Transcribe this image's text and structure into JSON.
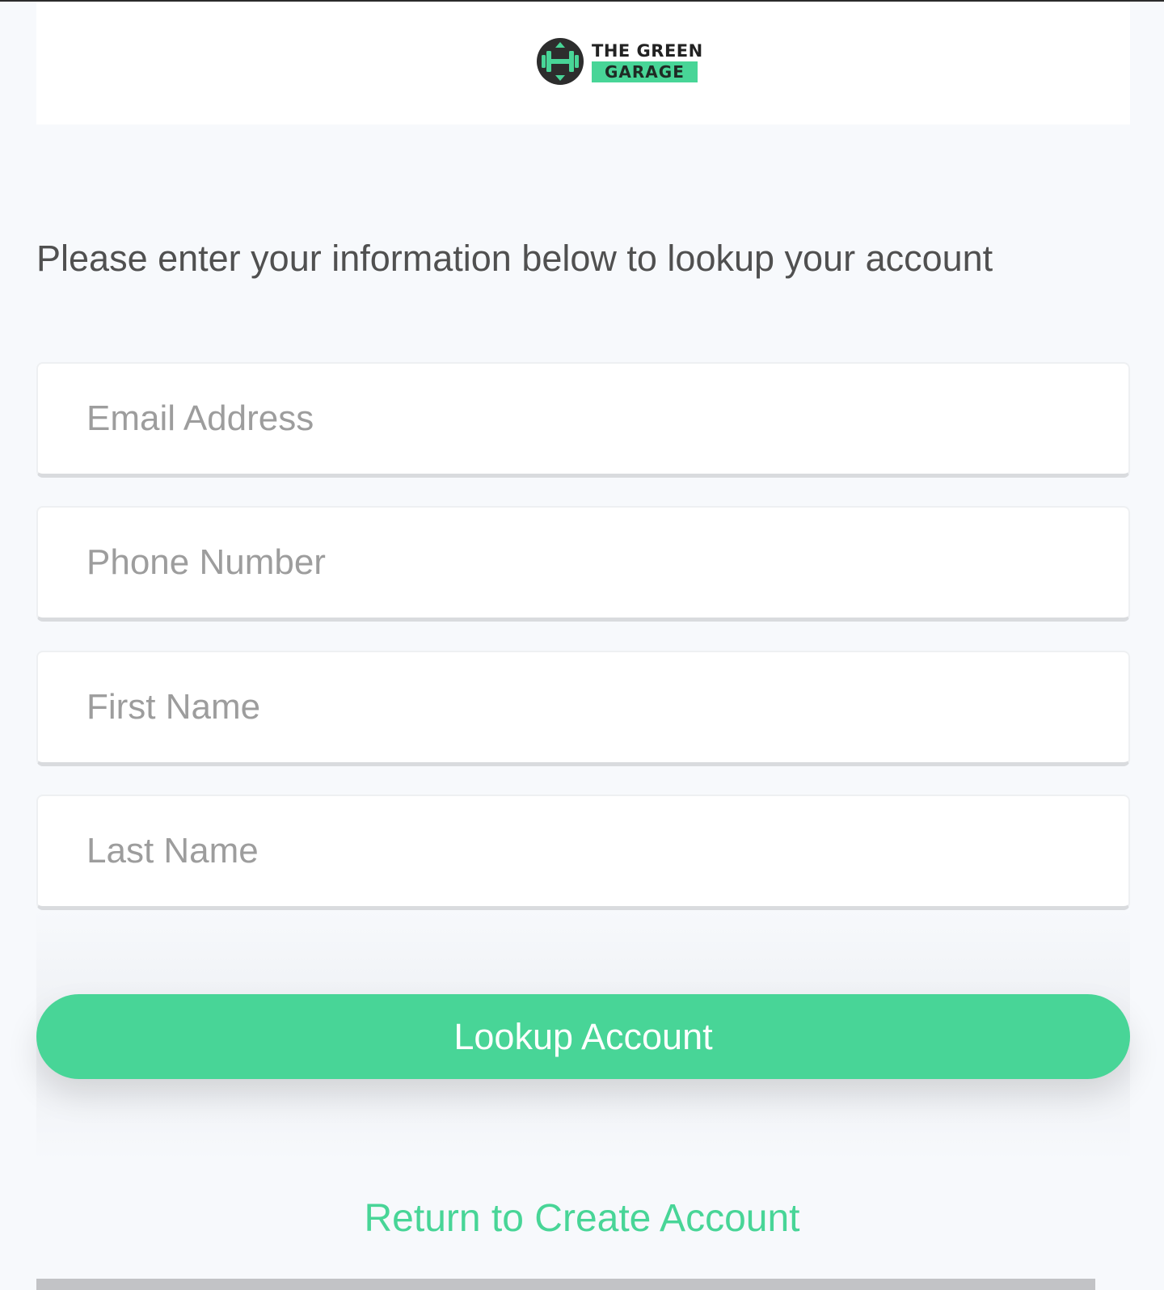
{
  "brand": {
    "line1": "THE GREEN",
    "line2": "GARAGE",
    "accent_color": "#48d597",
    "icon": "dumbbell-logo-icon"
  },
  "intro_text": "Please enter your information below to lookup your account",
  "form": {
    "email_placeholder": "Email Address",
    "phone_placeholder": "Phone Number",
    "first_name_placeholder": "First Name",
    "last_name_placeholder": "Last Name"
  },
  "lookup_button_label": "Lookup Account",
  "return_link_label": "Return to Create Account"
}
